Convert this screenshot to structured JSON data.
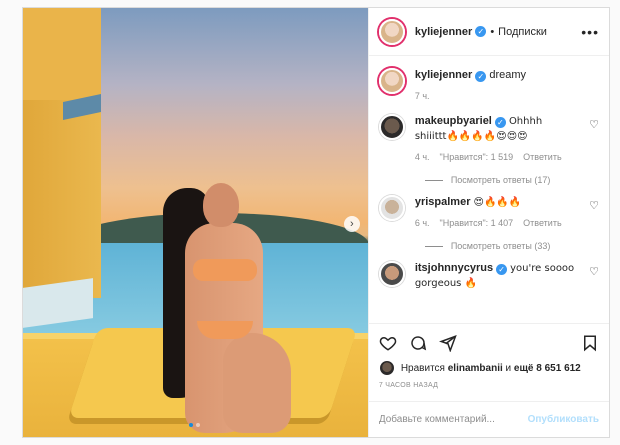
{
  "post": {
    "author": "kyliejenner",
    "separator": "•",
    "follow_status": "Подписки",
    "caption": "dreamy",
    "caption_time": "7 ч."
  },
  "comments": [
    {
      "user": "makeupbyariel",
      "text": "Ohhhh shiiittt🔥🔥🔥🔥😍😍😍",
      "time": "4 ч.",
      "likes": "\"Нравится\": 1 519",
      "reply": "Ответить",
      "replies": "Посмотреть ответы (17)"
    },
    {
      "user": "yrispalmer",
      "text": "😍🔥🔥🔥",
      "time": "6 ч.",
      "likes": "\"Нравится\": 1 407",
      "reply": "Ответить",
      "replies": "Посмотреть ответы (33)"
    },
    {
      "user": "itsjohnnycyrus",
      "text": "you're soooo gorgeous 🔥",
      "time": "",
      "likes": "",
      "reply": "",
      "replies": ""
    }
  ],
  "likes_line": {
    "prefix": "Нравится",
    "user": "elinambanii",
    "middle": "и",
    "count": "ещё 8 651 612"
  },
  "time_ago": "7 ЧАСОВ НАЗАД",
  "add_comment": {
    "placeholder": "Добавьте комментарий...",
    "publish": "Опубликовать"
  },
  "icons": {
    "more": "more-dots-icon",
    "heart": "heart-icon",
    "comment": "comment-icon",
    "share": "share-icon",
    "save": "bookmark-icon",
    "next": "chevron-right-icon"
  },
  "colors": {
    "verified": "#3897f0",
    "publish_disabled": "#b2dffc",
    "border": "#dbdbdb"
  }
}
